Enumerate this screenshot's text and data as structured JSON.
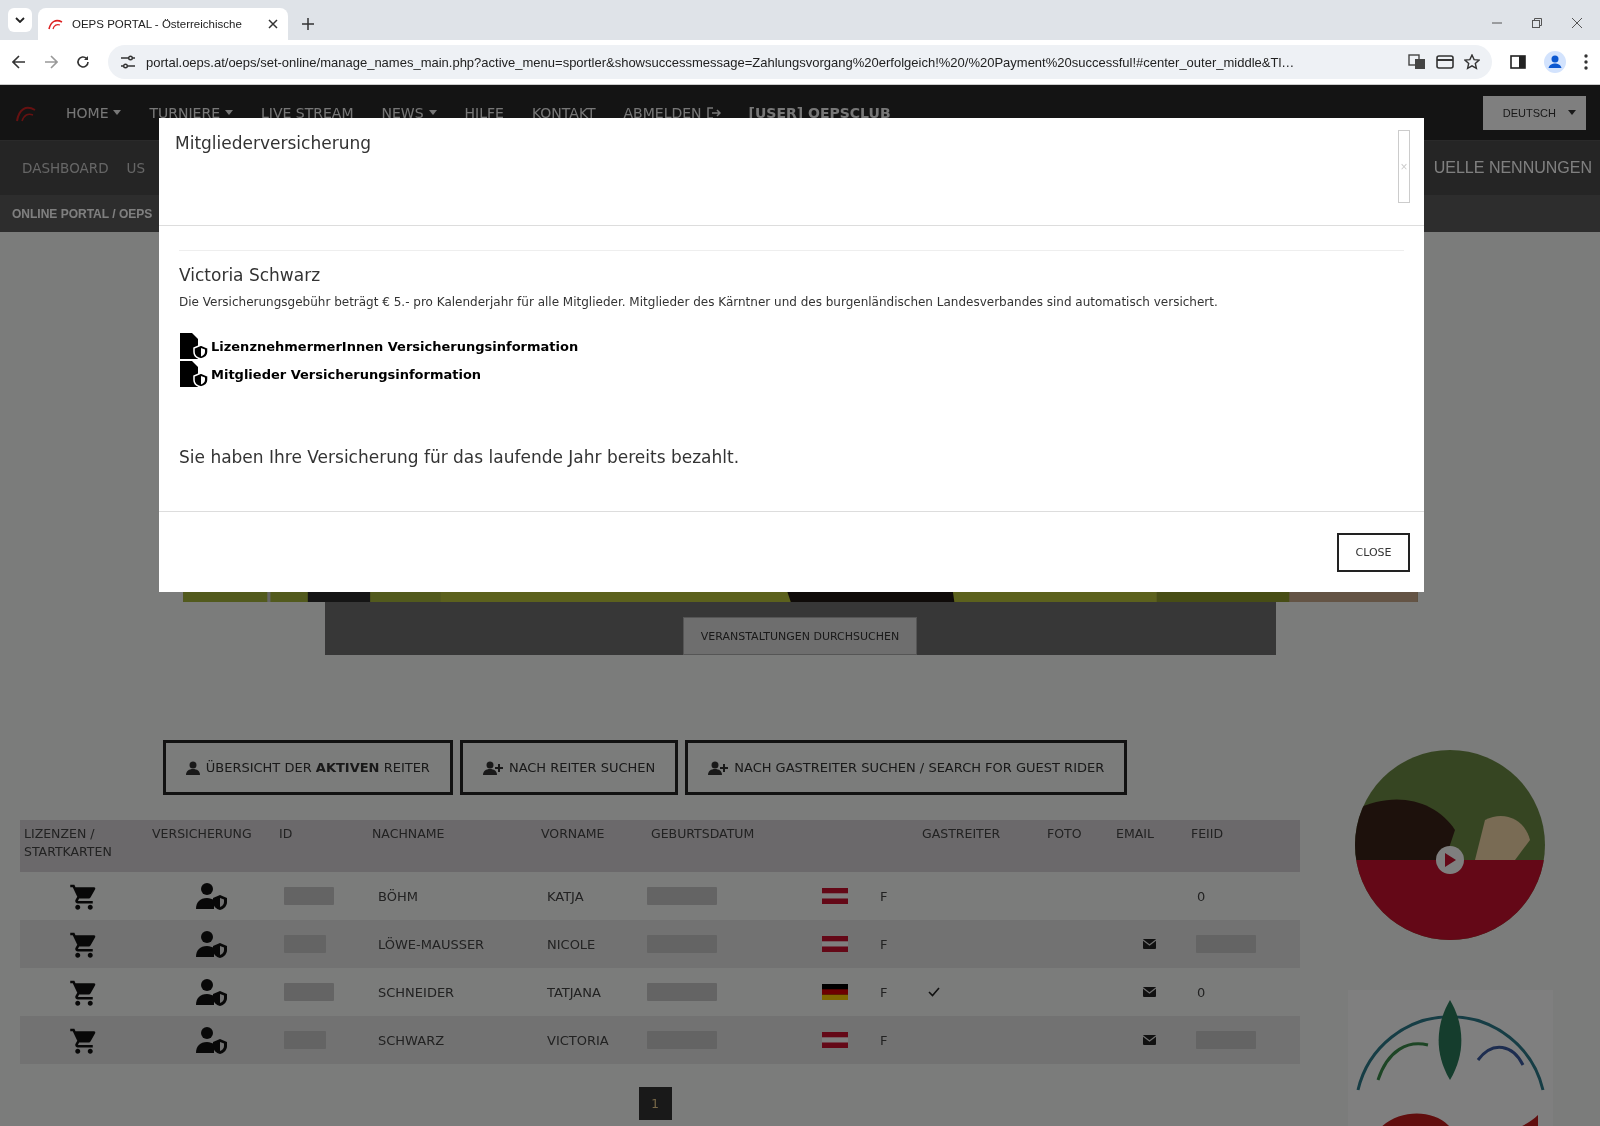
{
  "browser": {
    "tab_title": "OEPS PORTAL - Österreichische",
    "address": "portal.oeps.at/oeps/set-online/manage_names_main.php?active_menu=sportler&showsuccessmessage=Zahlungsvorgang%20erfolgeich!%20/%20Payment%20successful!#center_outer_middle&Tl…"
  },
  "nav": {
    "items": [
      {
        "label": "HOME",
        "kind": "dropdown"
      },
      {
        "label": "TURNIERE",
        "kind": "dropdown"
      },
      {
        "label": "LIVE STREAM",
        "kind": "link"
      },
      {
        "label": "NEWS",
        "kind": "dropdown"
      },
      {
        "label": "HILFE",
        "kind": "link"
      },
      {
        "label": "KONTAKT",
        "kind": "link"
      },
      {
        "label": "ABMELDEN",
        "kind": "logout"
      },
      {
        "label": "[USER] OEPSCLUB",
        "kind": "user"
      }
    ],
    "language": "DEUTSCH"
  },
  "subnav": {
    "items": [
      "DASHBOARD",
      "US"
    ],
    "right_item": "UELLE NENNUNGEN"
  },
  "breadcrumb": "ONLINE PORTAL / OEPS",
  "hero": {
    "search_button": "VERANSTALTUNGEN DURCHSUCHEN"
  },
  "actions": [
    {
      "label": "ÜBERSICHT DER **AKTIVEN** REITER",
      "kind": "overview"
    },
    {
      "label": "NACH REITER SUCHEN",
      "kind": "search"
    },
    {
      "label": "NACH GASTREITER SUCHEN / SEARCH FOR GUEST RIDER",
      "kind": "search"
    }
  ],
  "table": {
    "columns": [
      "LIZENZEN / STARTKARTEN",
      "VERSICHERUNG",
      "ID",
      "NACHNAME",
      "VORNAME",
      "GEBURTSDATUM",
      "GASTREITER",
      "FOTO",
      "EMAIL",
      "FEIID"
    ],
    "rows": [
      {
        "nachname": "BÖHM",
        "vorname": "KATJA",
        "kind": "austria",
        "gender": "F",
        "guest": false,
        "email": false,
        "feiid_hidden": false,
        "feiid": "0"
      },
      {
        "nachname": "LÖWE-MAUSSER",
        "vorname": "NICOLE",
        "kind": "austria",
        "gender": "F",
        "guest": false,
        "email": true,
        "feiid_hidden": true
      },
      {
        "nachname": "SCHNEIDER",
        "vorname": "TATJANA",
        "kind": "germany",
        "gender": "F",
        "guest": true,
        "email": true,
        "feiid_hidden": false,
        "feiid": "0"
      },
      {
        "nachname": "SCHWARZ",
        "vorname": "VICTORIA",
        "kind": "austria",
        "gender": "F",
        "guest": false,
        "email": true,
        "feiid_hidden": true
      }
    ]
  },
  "pagination": [
    {
      "label": "1",
      "selected": true
    }
  ],
  "modal": {
    "title": "Mitgliederversicherung",
    "close_symbol": "×",
    "name": "Victoria Schwarz",
    "note": "Die Versicherungsgebühr beträgt € 5.- pro Kalenderjahr für alle Mitglieder. Mitglieder des Kärntner und des burgenländischen Landesverbandes sind automatisch versichert.",
    "links": [
      "LizenznehmermerInnen Versicherungsinformation",
      "Mitglieder Versicherungsinformation"
    ],
    "message": "Sie haben Ihre Versicherung für das laufende Jahr bereits bezahlt.",
    "close_button": "CLOSE"
  }
}
